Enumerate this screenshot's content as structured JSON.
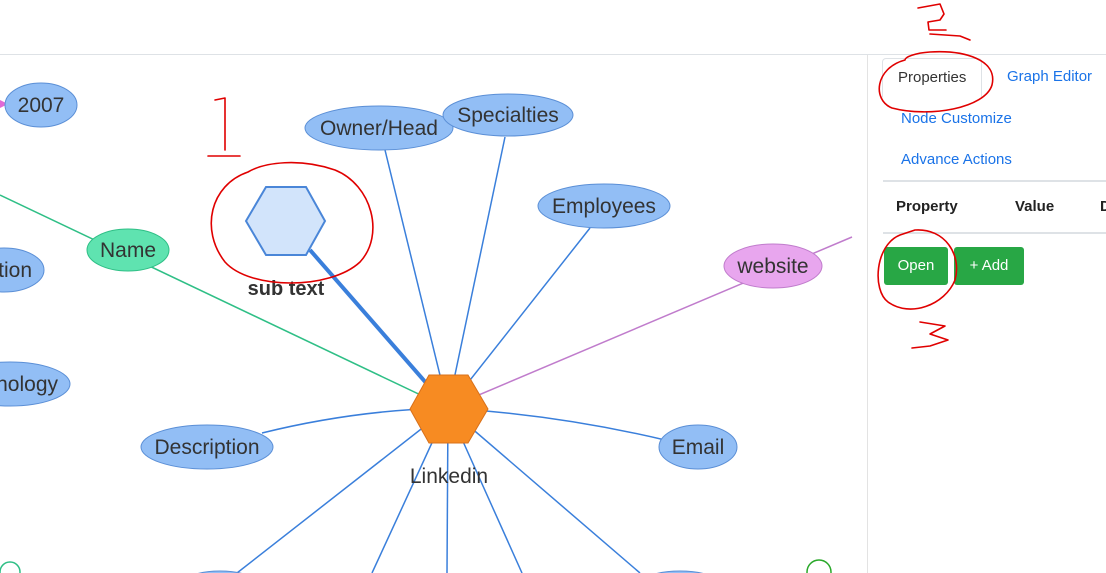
{
  "colors": {
    "node_blue": "#92bef5",
    "node_blue_stroke": "#5b8fd6",
    "node_green": "#5fe3b0",
    "node_purple": "#e8a6ee",
    "node_orange": "#f78b22",
    "sub_hex_fill": "#d2e4fb",
    "edge_blue": "#3a7fdb",
    "edge_green": "#2fbf86",
    "edge_purple": "#c07ccc",
    "annotation_red": "#e00000",
    "button_green": "#28a745",
    "link_blue": "#1a73e8"
  },
  "graph": {
    "nodes": {
      "year": "2007",
      "owner": "Owner/Head",
      "specialties": "Specialties",
      "employees": "Employees",
      "name": "Name",
      "location": "tion",
      "website": "website",
      "technology": "nology",
      "description": "Description",
      "email": "Email",
      "center": "Linkedin",
      "sub": "sub text"
    }
  },
  "side_panel": {
    "tabs": [
      "Properties",
      "Graph Editor"
    ],
    "links": [
      "Node Customize",
      "Advance Actions"
    ],
    "table_headers": [
      "Property",
      "Value",
      "D"
    ],
    "buttons": {
      "open": "Open",
      "add": "+ Add"
    }
  },
  "annotations": {
    "one": "1",
    "two": "2",
    "three": "3"
  }
}
